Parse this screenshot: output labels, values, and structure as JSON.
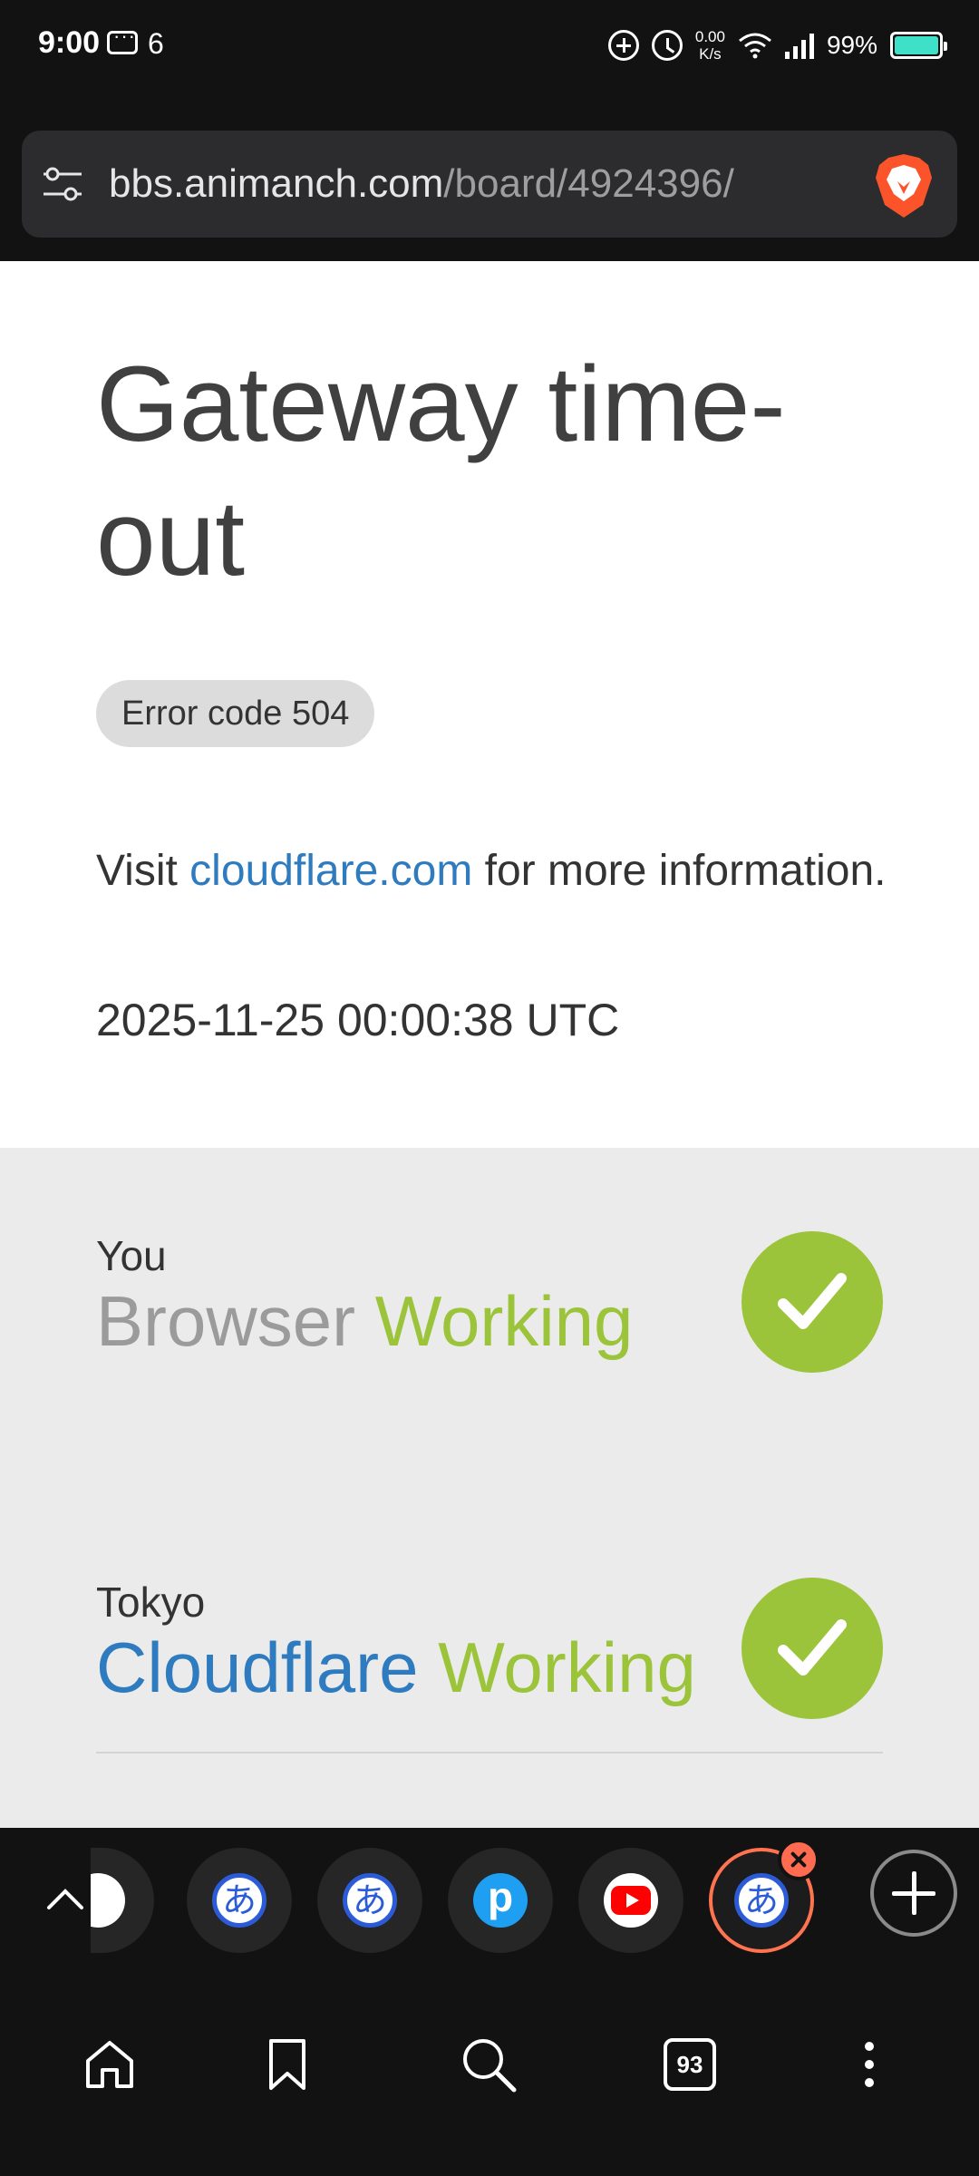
{
  "status_bar": {
    "time": "9:00",
    "notification_count": "6",
    "net_speed_value": "0.00",
    "net_speed_unit": "K/s",
    "battery_percent": "99%",
    "battery_level": 0.99,
    "battery_color": "#3ee0c8"
  },
  "address_bar": {
    "domain": "bbs.animanch.com",
    "path": "/board/4924396/",
    "tune_icon": "tune-icon",
    "shield_icon": "brave-lion-icon"
  },
  "error_page": {
    "title": "Gateway time-out",
    "error_code": "Error code 504",
    "visit_prefix": "Visit",
    "visit_link": "cloudflare.com",
    "visit_suffix": "for more information.",
    "timestamp": "2025-11-25 00:00:38 UTC",
    "status_rows": [
      {
        "location": "You",
        "service": "Browser",
        "status": "Working"
      },
      {
        "location": "Tokyo",
        "service": "Cloudflare",
        "status": "Working"
      }
    ],
    "colors": {
      "link": "#2f7bbf",
      "working": "#9bc43a"
    }
  },
  "tab_strip": {
    "open_tab_count": "93",
    "tabs": [
      {
        "favicon": "hiragana-a-icon"
      },
      {
        "favicon": "hiragana-a-icon"
      },
      {
        "favicon": "pixiv-icon"
      },
      {
        "favicon": "youtube-icon"
      },
      {
        "favicon": "hiragana-a-icon",
        "active": true
      }
    ],
    "favicon_glyph": "あ"
  },
  "bottom_nav": {
    "items": [
      "home-icon",
      "bookmark-icon",
      "search-icon",
      "tabs-icon",
      "more-icon"
    ]
  }
}
